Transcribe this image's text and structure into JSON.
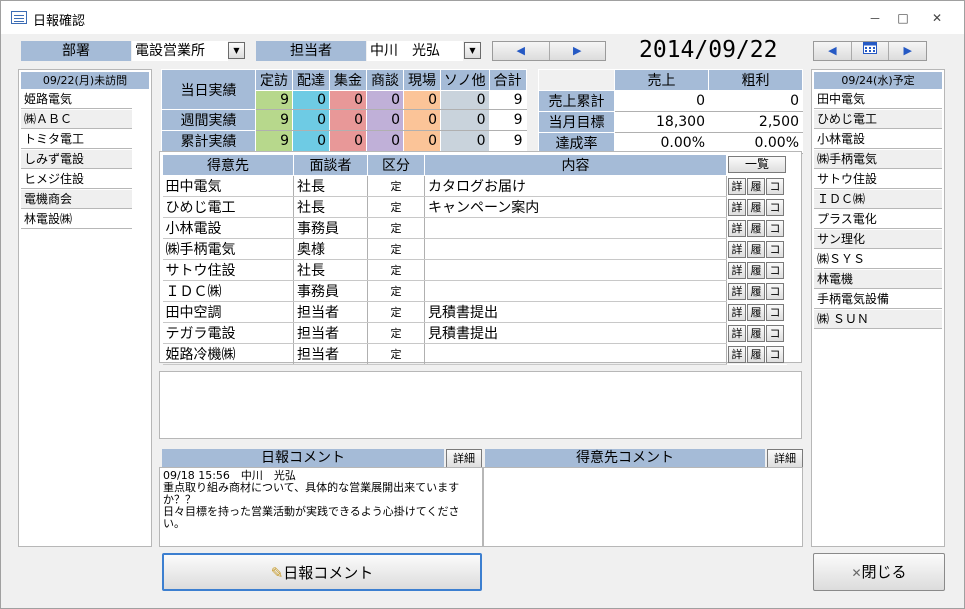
{
  "window": {
    "title": "日報確認",
    "minimize": "－",
    "maximize": "□",
    "close": "✕"
  },
  "header": {
    "dept_label": "部署",
    "dept_value": "電設営業所",
    "person_label": "担当者",
    "person_value": "中川　光弘",
    "date": "2014/09/22"
  },
  "left_panel": {
    "title": "09/22(月)未訪問",
    "items": [
      "姫路電気",
      "㈱ＡＢＣ",
      "トミタ電工",
      "しみず電設",
      "ヒメジ住設",
      "電機商会",
      "林電設㈱"
    ]
  },
  "right_panel": {
    "title": "09/24(水)予定",
    "items": [
      "田中電気",
      "ひめじ電工",
      "小林電設",
      "㈱手柄電気",
      "サトウ住設",
      "ＩＤＣ㈱",
      "プラス電化",
      "サン理化",
      "㈱ＳＹＳ",
      "林電機",
      "手柄電気設備",
      "㈱ ＳＵＮ"
    ]
  },
  "stats": {
    "headers": [
      "当日実績",
      "定訪",
      "配達",
      "集金",
      "商談",
      "現場",
      "ソノ他",
      "合計"
    ],
    "rows": [
      {
        "label": "当日実績",
        "values": [
          "9",
          "0",
          "0",
          "0",
          "0",
          "0",
          "9"
        ]
      },
      {
        "label": "週間実績",
        "values": [
          "9",
          "0",
          "0",
          "0",
          "0",
          "0",
          "9"
        ]
      },
      {
        "label": "累計実績",
        "values": [
          "9",
          "0",
          "0",
          "0",
          "0",
          "0",
          "9"
        ]
      }
    ]
  },
  "sales": {
    "headers": [
      "売上",
      "粗利"
    ],
    "rows": [
      {
        "label": "売上累計",
        "values": [
          "0",
          "0"
        ]
      },
      {
        "label": "当月目標",
        "values": [
          "18,300",
          "2,500"
        ]
      },
      {
        "label": "達成率",
        "values": [
          "0.00%",
          "0.00%"
        ]
      }
    ]
  },
  "customers": {
    "headers": [
      "得意先",
      "面談者",
      "区分",
      "内容"
    ],
    "list_button": "一覧",
    "btn_labels": [
      "詳",
      "履",
      "コ"
    ],
    "rows": [
      {
        "name": "田中電気",
        "contact": "社長",
        "kind": "定",
        "content": "カタログお届け"
      },
      {
        "name": "ひめじ電工",
        "contact": "社長",
        "kind": "定",
        "content": "キャンペーン案内"
      },
      {
        "name": "小林電設",
        "contact": "事務員",
        "kind": "定",
        "content": ""
      },
      {
        "name": "㈱手柄電気",
        "contact": "奥様",
        "kind": "定",
        "content": ""
      },
      {
        "name": "サトウ住設",
        "contact": "社長",
        "kind": "定",
        "content": ""
      },
      {
        "name": "ＩＤＣ㈱",
        "contact": "事務員",
        "kind": "定",
        "content": ""
      },
      {
        "name": "田中空調",
        "contact": "担当者",
        "kind": "定",
        "content": "見積書提出"
      },
      {
        "name": "テガラ電設",
        "contact": "担当者",
        "kind": "定",
        "content": "見積書提出"
      },
      {
        "name": "姫路冷機㈱",
        "contact": "担当者",
        "kind": "定",
        "content": ""
      }
    ]
  },
  "comments": {
    "daily_title": "日報コメント",
    "customer_title": "得意先コメント",
    "detail_label": "詳細",
    "daily_text": "09/18 15:56　中川　光弘\n重点取り組み商材について、具体的な営業展開出来ていますか？？\n日々目標を持った営業活動が実践できるよう心掛けてください。"
  },
  "buttons": {
    "comment": "日報コメント",
    "close": "閉じる"
  }
}
